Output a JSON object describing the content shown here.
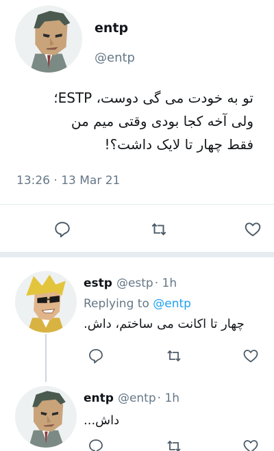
{
  "main_tweet": {
    "author_name": "entp",
    "author_handle": "@entp",
    "text_lines": [
      "تو به خودت می گی دوست، ESTP؛",
      "ولی آخه کجا بودی وقتی میم من",
      "فقط چهار تا لایک داشت؟!"
    ],
    "timestamp": "13:26 · 13 Mar 21"
  },
  "reply_1": {
    "author_name": "estp",
    "author_handle": "@estp",
    "age": "· 1h",
    "replying_prefix": "Replying to",
    "replying_mention": "@entp",
    "text": "چهار تا اکانت می ساختم، داش."
  },
  "reply_2": {
    "author_name": "entp",
    "author_handle": "@entp",
    "age": "· 1h",
    "text": "داش..."
  },
  "icons": [
    "reply-icon",
    "retweet-icon",
    "like-icon"
  ],
  "colors": {
    "text": "#0f1419",
    "secondary": "#657786",
    "link": "#1da1f2",
    "divider": "#e6ecf0"
  }
}
